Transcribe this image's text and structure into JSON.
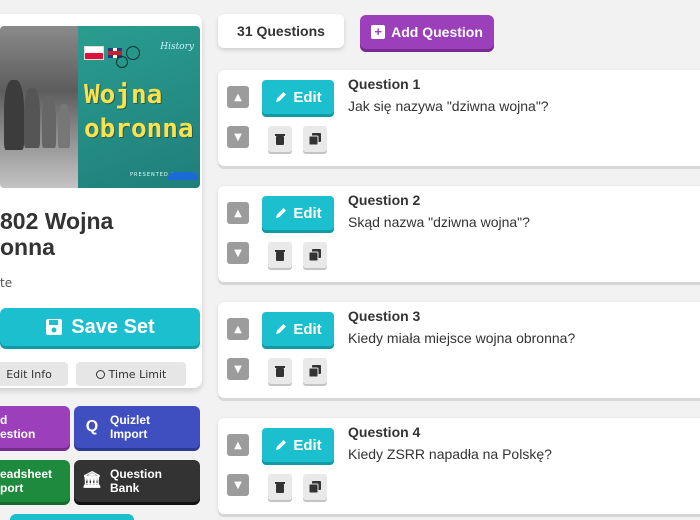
{
  "set": {
    "cover": {
      "subject": "History",
      "title_line1": "Wojna",
      "title_line2": "obronna",
      "presented_by": "PRESENTED BY"
    },
    "name": "802 Wojna\nonna",
    "meta": "te",
    "save_label": "Save Set",
    "edit_info_label": "Edit Info",
    "time_limit_label": "Time Limit"
  },
  "tools": [
    {
      "label": "d\nestion",
      "color": "#9b3fbb",
      "icon": "plus-icon"
    },
    {
      "label": "Quizlet\nImport",
      "color": "#3f4fbf",
      "icon": "quizlet-icon",
      "glyph": "Q"
    },
    {
      "label": "eadsheet\nport",
      "color": "#1e8a3e",
      "icon": "spreadsheet-icon"
    },
    {
      "label": "Question\nBank",
      "color": "#333333",
      "icon": "bank-icon",
      "glyph": "🏛"
    }
  ],
  "toolbar": {
    "count_label": "31 Questions",
    "add_label": "Add Question"
  },
  "questions": [
    {
      "title": "Question 1",
      "text": "Jak się nazywa \"dziwna wojna\"?",
      "edit_label": "Edit"
    },
    {
      "title": "Question 2",
      "text": "Skąd nazwa \"dziwna wojna\"?",
      "edit_label": "Edit"
    },
    {
      "title": "Question 3",
      "text": "Kiedy miała miejsce wojna obronna?",
      "edit_label": "Edit"
    },
    {
      "title": "Question 4",
      "text": "Kiedy ZSRR napadła na Polskę?",
      "edit_label": "Edit"
    }
  ],
  "colors": {
    "accent": "#1bbfcd",
    "purple": "#9b3fbb",
    "blue": "#3f4fbf",
    "green": "#1e8a3e",
    "dark": "#333333"
  }
}
